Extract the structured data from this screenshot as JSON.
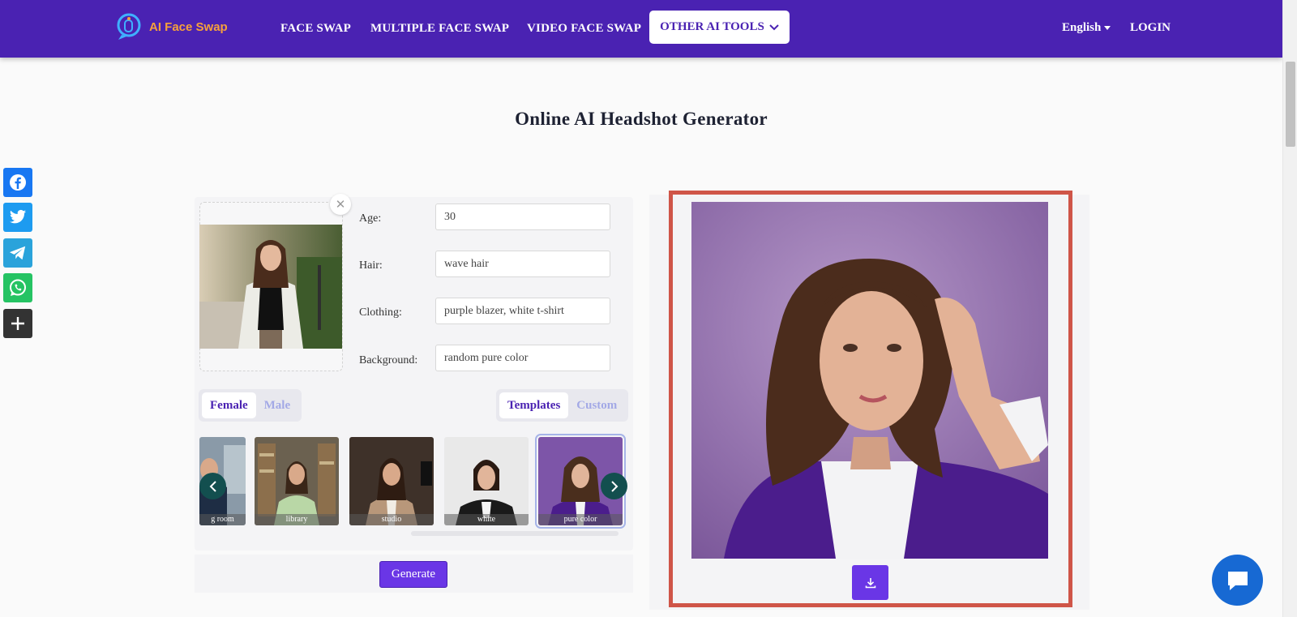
{
  "header": {
    "logo_text": "AI Face Swap",
    "nav": [
      "FACE SWAP",
      "MULTIPLE FACE SWAP",
      "VIDEO FACE SWAP"
    ],
    "tools_label": "OTHER AI TOOLS",
    "language": "English",
    "login": "LOGIN"
  },
  "page": {
    "title": "Online AI Headshot Generator"
  },
  "social": [
    "facebook-icon",
    "twitter-icon",
    "telegram-icon",
    "whatsapp-icon",
    "plus-icon"
  ],
  "form": {
    "age_label": "Age:",
    "age_value": "30",
    "hair_label": "Hair:",
    "hair_value": "wave hair",
    "clothing_label": "Clothing:",
    "clothing_value": "purple blazer, white t-shirt",
    "background_label": "Background:",
    "background_value": "random pure color"
  },
  "gender": {
    "female": "Female",
    "male": "Male"
  },
  "mode": {
    "templates": "Templates",
    "custom": "Custom"
  },
  "templates": [
    "g room",
    "library",
    "studio",
    "white",
    "pure color"
  ],
  "generate_label": "Generate",
  "colors": {
    "brand": "#4a22b2",
    "button": "#6a36e6",
    "frame": "#cf5548",
    "chat": "#1769d3"
  }
}
